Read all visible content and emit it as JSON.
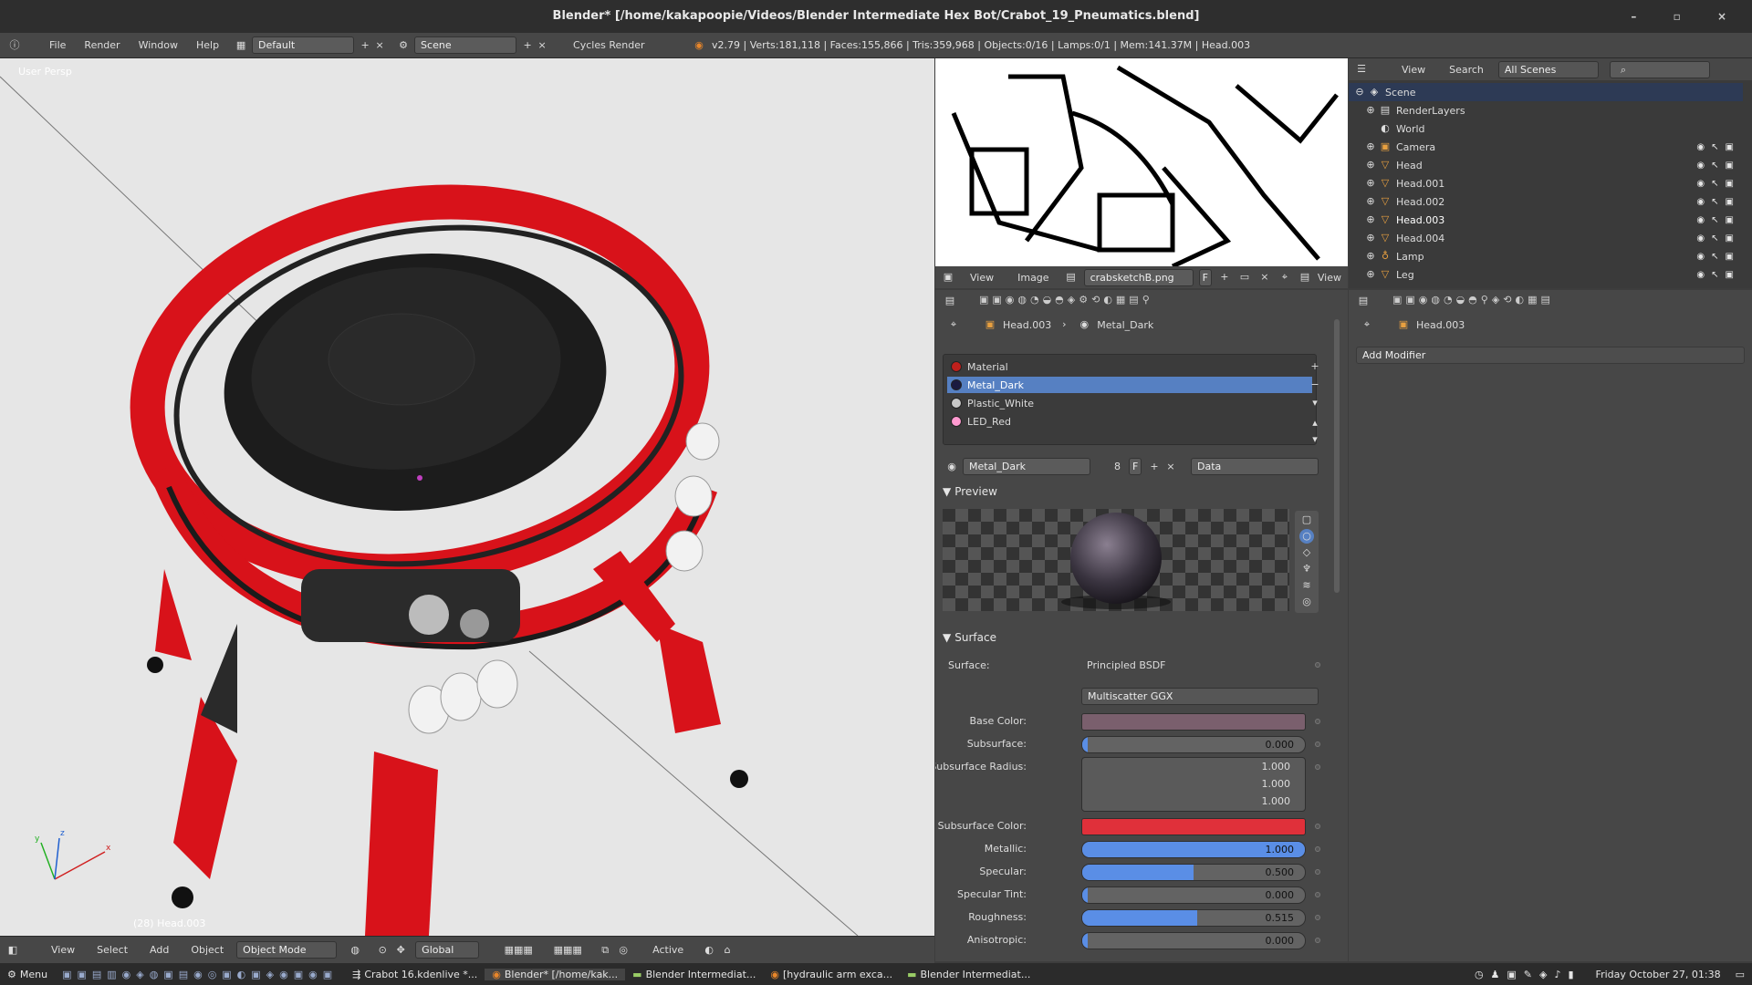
{
  "window": {
    "title": "Blender* [/home/kakapoopie/Videos/Blender Intermediate Hex Bot/Crabot_19_Pneumatics.blend]",
    "controls": [
      "–",
      "▫",
      "×"
    ]
  },
  "info_header": {
    "menus": [
      "File",
      "Render",
      "Window",
      "Help"
    ],
    "layout": "Default",
    "scene": "Scene",
    "engine": "Cycles Render",
    "stats": "v2.79 | Verts:181,118 | Faces:155,866 | Tris:359,968 | Objects:0/16 | Lamps:0/1 | Mem:141.37M | Head.003"
  },
  "viewport": {
    "label": "User Persp",
    "object_label": "(28) Head.003",
    "header": {
      "menus": [
        "View",
        "Select",
        "Add",
        "Object"
      ],
      "mode": "Object Mode",
      "orientation": "Global",
      "pivot_label": "Active"
    },
    "axes": {
      "x": "x",
      "y": "y",
      "z": "z"
    }
  },
  "image_editor": {
    "menus": [
      "View",
      "Image"
    ],
    "image_name": "crabsketchB.png",
    "fake_user": "F",
    "view_label": "View"
  },
  "outliner": {
    "menus": [
      "View",
      "Search"
    ],
    "display_mode": "All Scenes",
    "items": [
      {
        "label": "Scene",
        "level": 0,
        "icon": "scene-icon",
        "selected": true
      },
      {
        "label": "RenderLayers",
        "level": 1,
        "icon": "renderlayers-icon"
      },
      {
        "label": "World",
        "level": 1,
        "icon": "world-icon"
      },
      {
        "label": "Camera",
        "level": 1,
        "icon": "camera-icon"
      },
      {
        "label": "Head",
        "level": 1,
        "icon": "mesh-icon"
      },
      {
        "label": "Head.001",
        "level": 1,
        "icon": "mesh-icon"
      },
      {
        "label": "Head.002",
        "level": 1,
        "icon": "mesh-icon"
      },
      {
        "label": "Head.003",
        "level": 1,
        "icon": "mesh-icon"
      },
      {
        "label": "Head.004",
        "level": 1,
        "icon": "mesh-icon"
      },
      {
        "label": "Lamp",
        "level": 1,
        "icon": "lamp-icon"
      },
      {
        "label": "Leg",
        "level": 1,
        "icon": "mesh-icon"
      }
    ]
  },
  "material_props": {
    "breadcrumb": [
      "Head.003",
      "Metal_Dark"
    ],
    "slots": [
      {
        "name": "Material",
        "color": "#c0201c"
      },
      {
        "name": "Metal_Dark",
        "color": "#1a1a40",
        "selected": true
      },
      {
        "name": "Plastic_White",
        "color": "#c8c8c8"
      },
      {
        "name": "LED_Red",
        "color": "#ff9ad0"
      }
    ],
    "datablock": {
      "name": "Metal_Dark",
      "users": "8",
      "fake_user": "F",
      "link": "Data"
    },
    "preview_title": "Preview",
    "surface_title": "Surface",
    "surface_label": "Surface:",
    "surface_shader": "Principled BSDF",
    "distribution": "Multiscatter GGX",
    "fields": [
      {
        "label": "Base Color:",
        "type": "color",
        "color": "#7a5f6d"
      },
      {
        "label": "Subsurface:",
        "type": "slider",
        "value": "0.000",
        "fraction": 0
      },
      {
        "label": "Subsurface Radius:",
        "type": "vector",
        "values": [
          "1.000",
          "1.000",
          "1.000"
        ]
      },
      {
        "label": "Subsurface Color:",
        "type": "color",
        "color": "#e0303a"
      },
      {
        "label": "Metallic:",
        "type": "slider",
        "value": "1.000",
        "fraction": 1
      },
      {
        "label": "Specular:",
        "type": "slider",
        "value": "0.500",
        "fraction": 0.5
      },
      {
        "label": "Specular Tint:",
        "type": "slider",
        "value": "0.000",
        "fraction": 0
      },
      {
        "label": "Roughness:",
        "type": "slider",
        "value": "0.515",
        "fraction": 0.515
      },
      {
        "label": "Anisotropic:",
        "type": "slider",
        "value": "0.000",
        "fraction": 0
      }
    ]
  },
  "modifier_props": {
    "breadcrumb": [
      "Head.003"
    ],
    "add_modifier": "Add Modifier"
  },
  "taskbar": {
    "menu": "Menu",
    "tasks": [
      "Crabot 16.kdenlive *...",
      "Blender* [/home/kak...",
      "Blender Intermediat...",
      "[hydraulic arm exca...",
      "Blender Intermediat..."
    ],
    "clock": "Friday October 27, 01:38"
  },
  "colors": {
    "accent": "#5680c2",
    "robot_red": "#d8121a",
    "viewport_bg": "#e6e6e6"
  }
}
